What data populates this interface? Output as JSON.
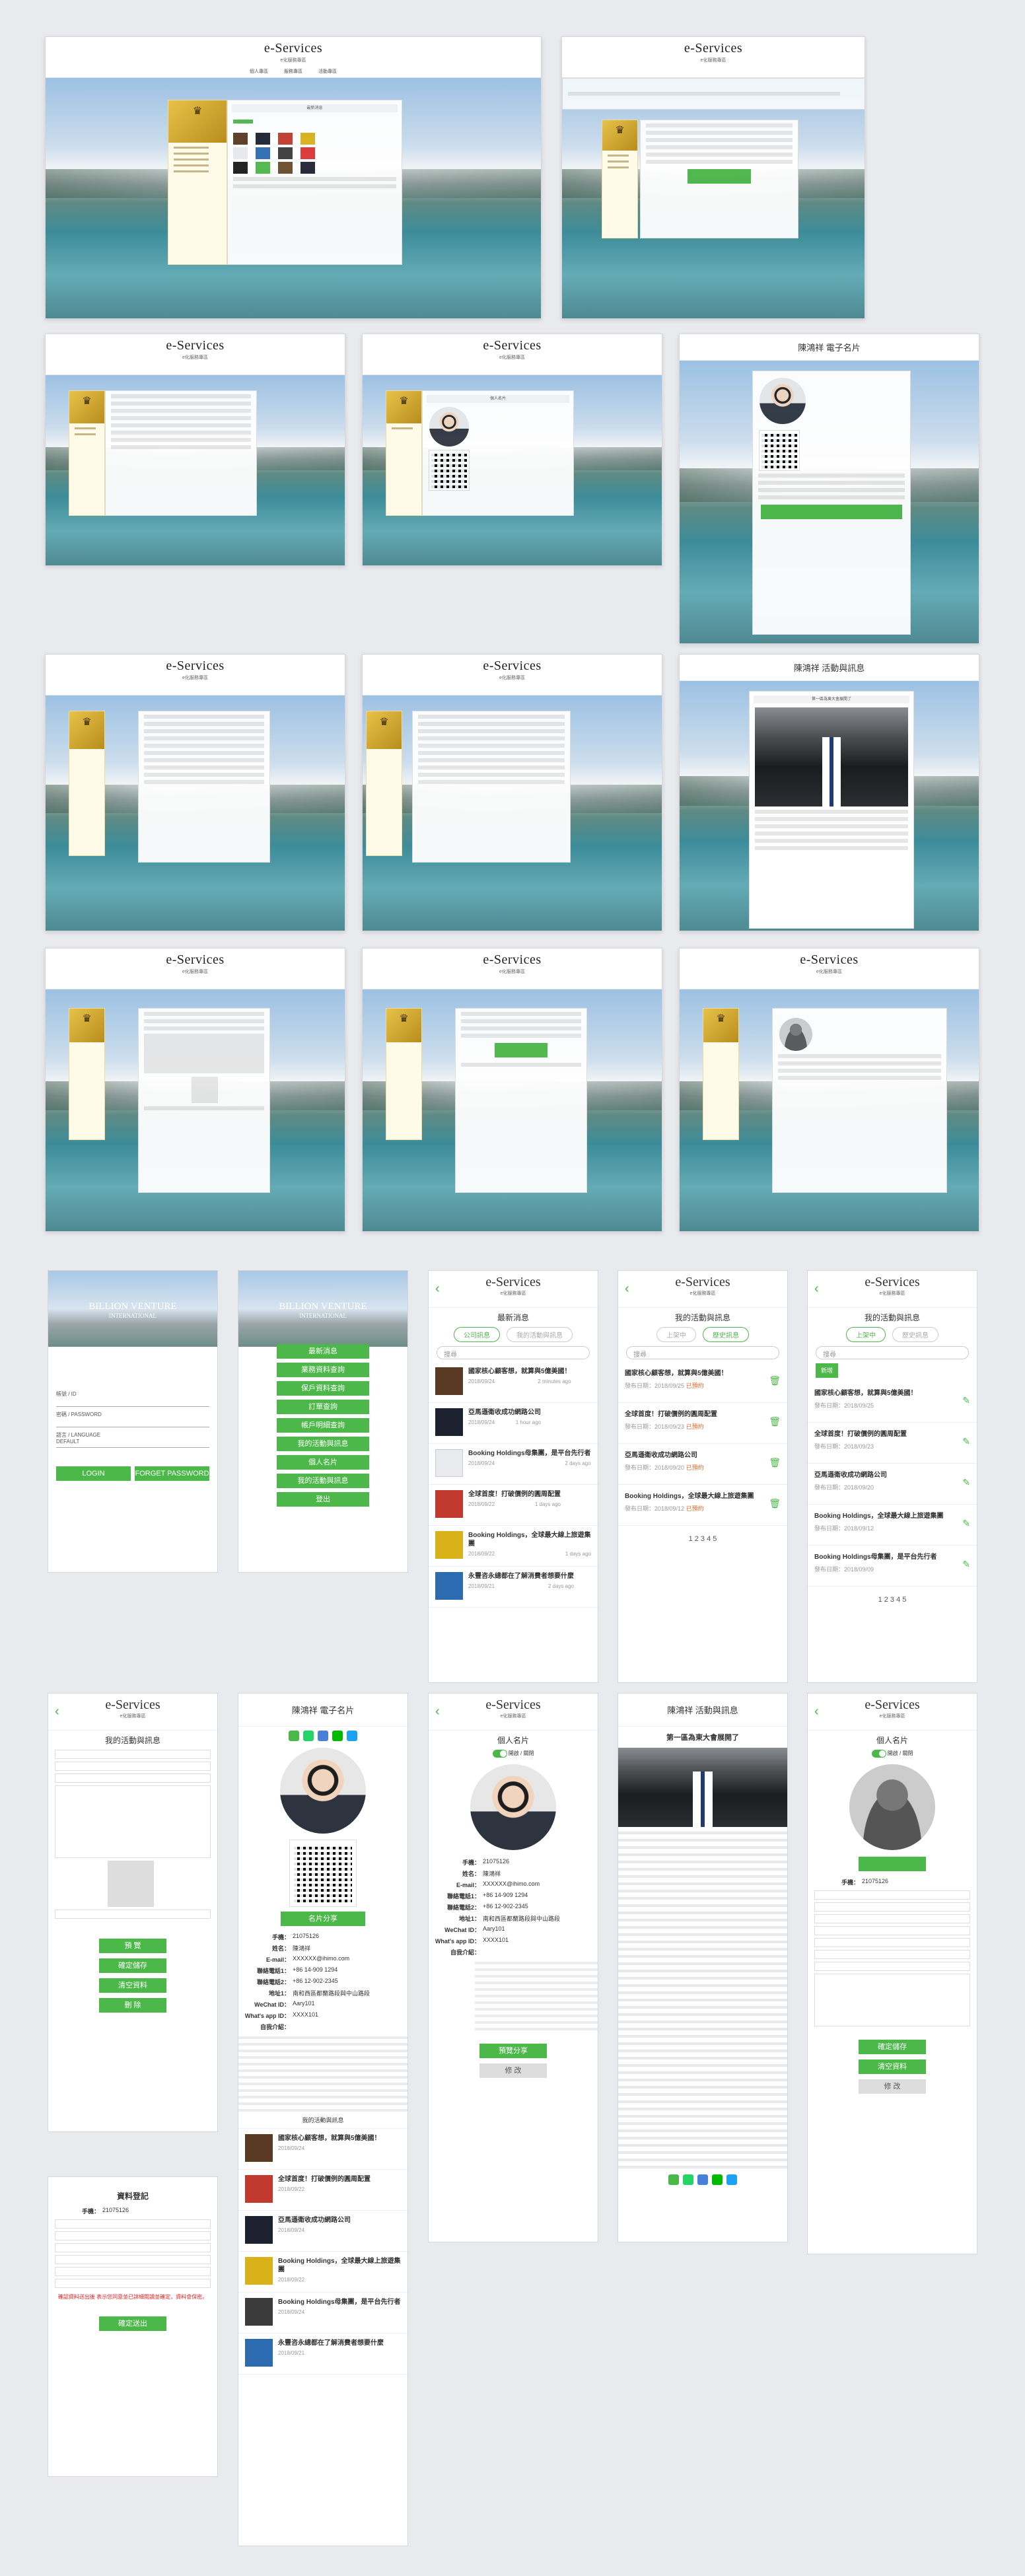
{
  "brand": {
    "logo": "e-Services",
    "sub": "e化服務專區"
  },
  "desktop": {
    "nav": [
      "個人專區",
      "服務專區",
      "活動專區"
    ]
  },
  "headings": {
    "card_title": "陳鴻祥 電子名片",
    "activity_title": "陳鴻祥 活動與訊息",
    "activity_headline": "第一區為東大會展開了"
  },
  "login": {
    "brand1": "BILLION VENTURE",
    "brand2": "INTERNATIONAL",
    "account": "帳號 / ID",
    "password": "密碼 / PASSWORD",
    "language": "語言 / LANGUAGE",
    "language_value": "DEFAULT",
    "login_btn": "LOGIN",
    "forgot_btn": "FORGET PASSWORD"
  },
  "menu": [
    "最新消息",
    "業務資料查詢",
    "保戶資料查詢",
    "訂單查詢",
    "帳戶明細查詢",
    "我的活動與訊息",
    "個人名片",
    "我的活動與訊息",
    "登出"
  ],
  "news": {
    "title": "最新消息",
    "tab_on": "公司訊息",
    "tab_off": "我的活動與訊息",
    "search": "搜尋",
    "items": [
      {
        "t": "國家核心顧客想，就算與5億美國！",
        "d": "2018/09/24",
        "a": "2 minutes ago",
        "c": "#5a3a22"
      },
      {
        "t": "亞馬遜衛收成功網路公司",
        "d": "2018/09/24",
        "a": "1 hour ago",
        "c": "#1c2230"
      },
      {
        "t": "Booking Holdings母集團，是平台先行者",
        "d": "2018/09/24",
        "a": "2 days ago",
        "c": "#e8eaee"
      },
      {
        "t": "全球首度！打破價例的圓周配置",
        "d": "2018/09/22",
        "a": "1 days ago",
        "c": "#c23a2f"
      },
      {
        "t": "Booking Holdings，全球最大線上旅遊集團",
        "d": "2018/09/22",
        "a": "1 days ago",
        "c": "#d9b21a"
      },
      {
        "t": "永豐咨永總都在了解消費者想要什麼",
        "d": "2018/09/21",
        "a": "2 days ago",
        "c": "#2c6bb0"
      }
    ]
  },
  "acts": {
    "title": "我的活動與訊息",
    "tab1": "上架中",
    "tab2": "歷史訊息",
    "new_btn": "新增",
    "items": [
      {
        "t": "國家核心顧客想，就算與5億美國！",
        "d": "2018/09/25",
        "s": "已預約"
      },
      {
        "t": "全球首度！打破價例的圓周配置",
        "d": "2018/09/23",
        "s": "已預約"
      },
      {
        "t": "亞馬遜衛收成功網路公司",
        "d": "2018/09/20",
        "s": "已預約"
      },
      {
        "t": "Booking Holdings，全球最大線上旅遊集團",
        "d": "2018/09/12",
        "s": "已預約"
      },
      {
        "t": "Booking Holdings母集團，是平台先行者",
        "d": "2018/09/09",
        "s": "已預約"
      }
    ],
    "label_date": "發布日期：",
    "label_status": "發布狀態：",
    "pager": "1 2 3 4 5"
  },
  "card": {
    "title": "個人名片",
    "phone": "21075126",
    "name": "陳鴻祥",
    "email": "XXXXXX@ihimo.com",
    "tel1": "+86 14-909 1294",
    "tel2": "+86 12-902-2345",
    "addr": "南和西區都蘭路段與中山路段",
    "wechat": "Aary101",
    "whatsapp": "XXXX101",
    "save_btn": "預覽分享",
    "back_btn": "修 改",
    "k_phone": "手機：",
    "k_name": "姓名：",
    "k_email": "E-mail：",
    "k_tel1": "聯絡電話1：",
    "k_tel2": "聯絡電話2：",
    "k_addr": "地址1：",
    "k_wechat": "WeChat ID：",
    "k_whatsapp": "What's app ID：",
    "k_intro": "自我介紹：",
    "save_share": "名片分享",
    "toggle": "開啟 / 關閉"
  },
  "register": {
    "title": "資料登記",
    "phone": "21075126",
    "buttons": [
      "預 覽",
      "確定儲存",
      "清空資料",
      "刪 除"
    ],
    "submit": "確定送出",
    "warn": "確認資料送出後 表示您同意並已詳細閱讀並確定，資料會保密。"
  },
  "colors": {
    "green": "#4cb849",
    "gold": "#d4a630",
    "orange": "#e06a2b"
  }
}
